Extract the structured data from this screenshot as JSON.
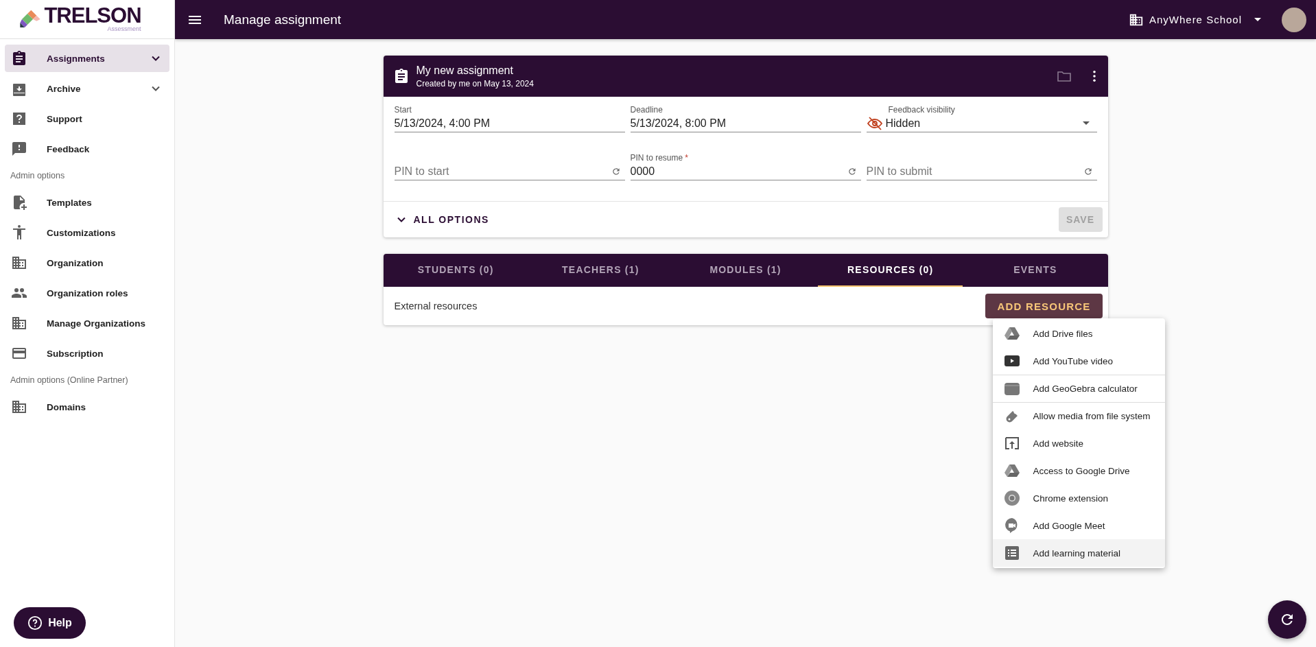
{
  "brand": {
    "name": "TRELSON",
    "tagline": "Assessment"
  },
  "sidebar": {
    "items": [
      {
        "kind": "link",
        "label": "Assignments",
        "selected": true,
        "expanded": false
      },
      {
        "kind": "link",
        "label": "Archive",
        "selected": false,
        "expanded": false
      },
      {
        "kind": "link",
        "label": "Support",
        "selected": false
      },
      {
        "kind": "link",
        "label": "Feedback",
        "selected": false
      },
      {
        "kind": "section",
        "label": "Admin options"
      },
      {
        "kind": "link",
        "label": "Templates",
        "selected": false
      },
      {
        "kind": "link",
        "label": "Customizations",
        "selected": false
      },
      {
        "kind": "link",
        "label": "Organization",
        "selected": false
      },
      {
        "kind": "link",
        "label": "Organization roles",
        "selected": false
      },
      {
        "kind": "link",
        "label": "Manage Organizations",
        "selected": false
      },
      {
        "kind": "link",
        "label": "Subscription",
        "selected": false
      },
      {
        "kind": "section",
        "label": "Admin options (Online Partner)"
      },
      {
        "kind": "link",
        "label": "Domains",
        "selected": false
      }
    ]
  },
  "help_button": "Help",
  "header": {
    "title": "Manage assignment",
    "school": "AnyWhere School"
  },
  "assignment": {
    "title": "My new assignment",
    "subtitle": "Created by me on May 13, 2024",
    "fields": [
      {
        "kind": "text",
        "label": "Start",
        "value": "5/13/2024, 4:00 PM"
      },
      {
        "kind": "text",
        "label": "Deadline",
        "value": "5/13/2024, 8:00 PM"
      },
      {
        "kind": "select",
        "label": "Feedback visibility",
        "value": "Hidden"
      },
      {
        "kind": "pin",
        "placeholder": "PIN to start"
      },
      {
        "kind": "pin",
        "label": "PIN to resume",
        "value": "0000",
        "required_mark": "*"
      },
      {
        "kind": "pin",
        "placeholder": "PIN to submit"
      }
    ],
    "all_options": "ALL OPTIONS",
    "save": {
      "label": "SAVE",
      "disabled": true
    }
  },
  "tabs": [
    {
      "label": "STUDENTS (0)",
      "selected": false
    },
    {
      "label": "TEACHERS (1)",
      "selected": false
    },
    {
      "label": "MODULES (1)",
      "selected": false
    },
    {
      "label": "RESOURCES (0)",
      "selected": true
    },
    {
      "label": "EVENTS",
      "selected": false
    }
  ],
  "resources": {
    "label": "External resources",
    "add_button": "ADD RESOURCE"
  },
  "menu": [
    {
      "label": "Add Drive files",
      "divider_before": false,
      "hovered": false
    },
    {
      "label": "Add YouTube video",
      "divider_before": false,
      "hovered": false
    },
    {
      "label": "Add GeoGebra calculator",
      "divider_before": true,
      "hovered": false
    },
    {
      "label": "Allow media from file system",
      "divider_before": true,
      "hovered": false
    },
    {
      "label": "Add website",
      "divider_before": false,
      "hovered": false
    },
    {
      "label": "Access to Google Drive",
      "divider_before": false,
      "hovered": false
    },
    {
      "label": "Chrome extension",
      "divider_before": false,
      "hovered": false
    },
    {
      "label": "Add Google Meet",
      "divider_before": false,
      "hovered": false
    },
    {
      "label": "Add learning material",
      "divider_before": false,
      "hovered": true
    }
  ]
}
